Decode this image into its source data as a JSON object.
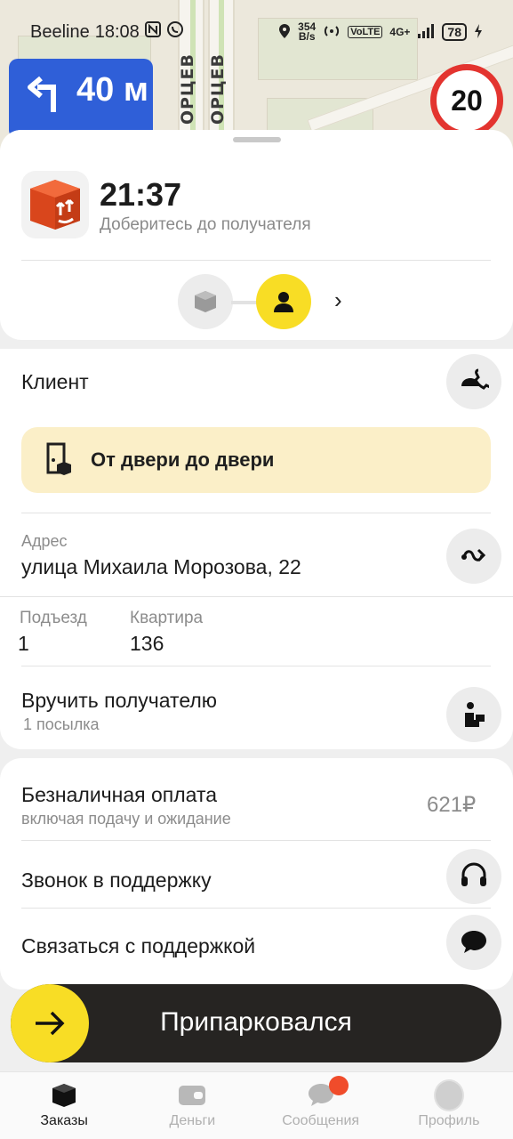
{
  "status_bar": {
    "carrier": "Beeline",
    "time": "18:08",
    "net_speed_value": "354",
    "net_speed_unit": "B/s",
    "volte": "VoLTE",
    "network": "4G+",
    "battery": "78"
  },
  "map": {
    "street_left": "ОРЦЕВ",
    "street_right": "ОРЦЕВ"
  },
  "navigation": {
    "distance": "40 м",
    "speed_limit": "20"
  },
  "order": {
    "eta": "21:37",
    "eta_subtitle": "Доберитесь до получателя"
  },
  "client": {
    "label": "Клиент"
  },
  "delivery_type": {
    "label": "От двери до двери"
  },
  "address": {
    "caption": "Адрес",
    "value": "улица Михаила Морозова, 22"
  },
  "entrance": {
    "caption": "Подъезд",
    "value": "1"
  },
  "apartment": {
    "caption": "Квартира",
    "value": "136"
  },
  "handover": {
    "label": "Вручить получателю",
    "sub": "1 посылка"
  },
  "payment": {
    "label": "Безналичная оплата",
    "sub": "включая подачу и ожидание",
    "price": "621₽"
  },
  "support_call": {
    "label": "Звонок в поддержку"
  },
  "support_chat": {
    "label": "Связаться с поддержкой"
  },
  "action": {
    "label": "Припарковался"
  },
  "tabs": [
    {
      "label": "Заказы"
    },
    {
      "label": "Деньги"
    },
    {
      "label": "Сообщения"
    },
    {
      "label": "Профиль"
    }
  ],
  "colors": {
    "accent_yellow": "#f8dd25",
    "nav_blue": "#2f5fd8",
    "speed_red": "#e3342f",
    "button_dark": "#262422"
  }
}
